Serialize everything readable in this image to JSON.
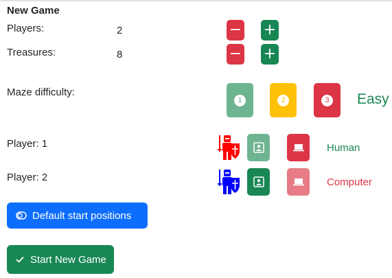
{
  "title": "New Game",
  "players": {
    "label": "Players:",
    "value": "2"
  },
  "treasures": {
    "label": "Treasures:",
    "value": "8"
  },
  "controls": {
    "minus": "−",
    "plus": "+"
  },
  "difficulty": {
    "label": "Maze difficulty:",
    "levels": [
      "1",
      "2",
      "3"
    ],
    "current": "Easy",
    "colors": {
      "level1": "#6fb491",
      "level2": "#ffc107",
      "level3": "#dc3545",
      "current_text": "#198754"
    }
  },
  "player_rows": [
    {
      "label": "Player: 1",
      "type": "Human",
      "color": "#ff0000",
      "type_color": "#198754"
    },
    {
      "label": "Player: 2",
      "type": "Computer",
      "color": "#0000ff",
      "type_color": "#dc3545"
    }
  ],
  "buttons": {
    "default_positions": "Default start positions",
    "start_game": "Start New Game"
  },
  "icons": {
    "minus": "minus-icon",
    "plus": "plus-icon",
    "human": "person-photo-icon",
    "computer": "laptop-icon",
    "knight": "knight-icon",
    "toggle": "toggle-icon",
    "check": "check-icon"
  }
}
